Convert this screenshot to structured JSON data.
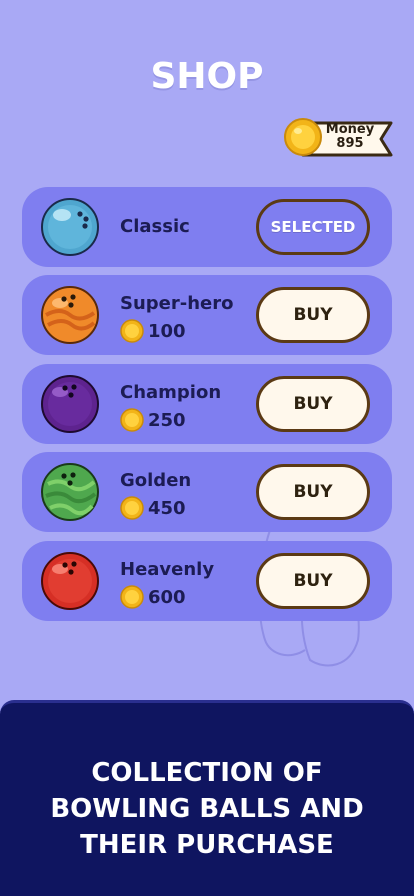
{
  "shop": {
    "title": "SHOP",
    "money_label": "Money",
    "money_value": "895"
  },
  "balls": [
    {
      "name": "Classic",
      "price": "",
      "button": "SELECTED",
      "selected": true,
      "icon": "classic-ball-icon",
      "color": "#4fa6cf"
    },
    {
      "name": "Super-hero",
      "price": "100",
      "button": "BUY",
      "selected": false,
      "icon": "super-hero-ball-icon",
      "color": "#f08a2a"
    },
    {
      "name": "Champion",
      "price": "250",
      "button": "BUY",
      "selected": false,
      "icon": "champion-ball-icon",
      "color": "#5e238f"
    },
    {
      "name": "Golden",
      "price": "450",
      "button": "BUY",
      "selected": false,
      "icon": "golden-ball-icon",
      "color": "#4fa84e"
    },
    {
      "name": "Heavenly",
      "price": "600",
      "button": "BUY",
      "selected": false,
      "icon": "heavenly-ball-icon",
      "color": "#d62f25"
    }
  ],
  "banner": {
    "line1": "COLLECTION OF",
    "line2": "BOWLING BALLS AND",
    "line3": "THEIR PURCHASE"
  },
  "colors": {
    "background": "#a9a9f5",
    "card": "#7f7ef0",
    "button_border": "#5b3a14",
    "banner": "#0f1560"
  }
}
